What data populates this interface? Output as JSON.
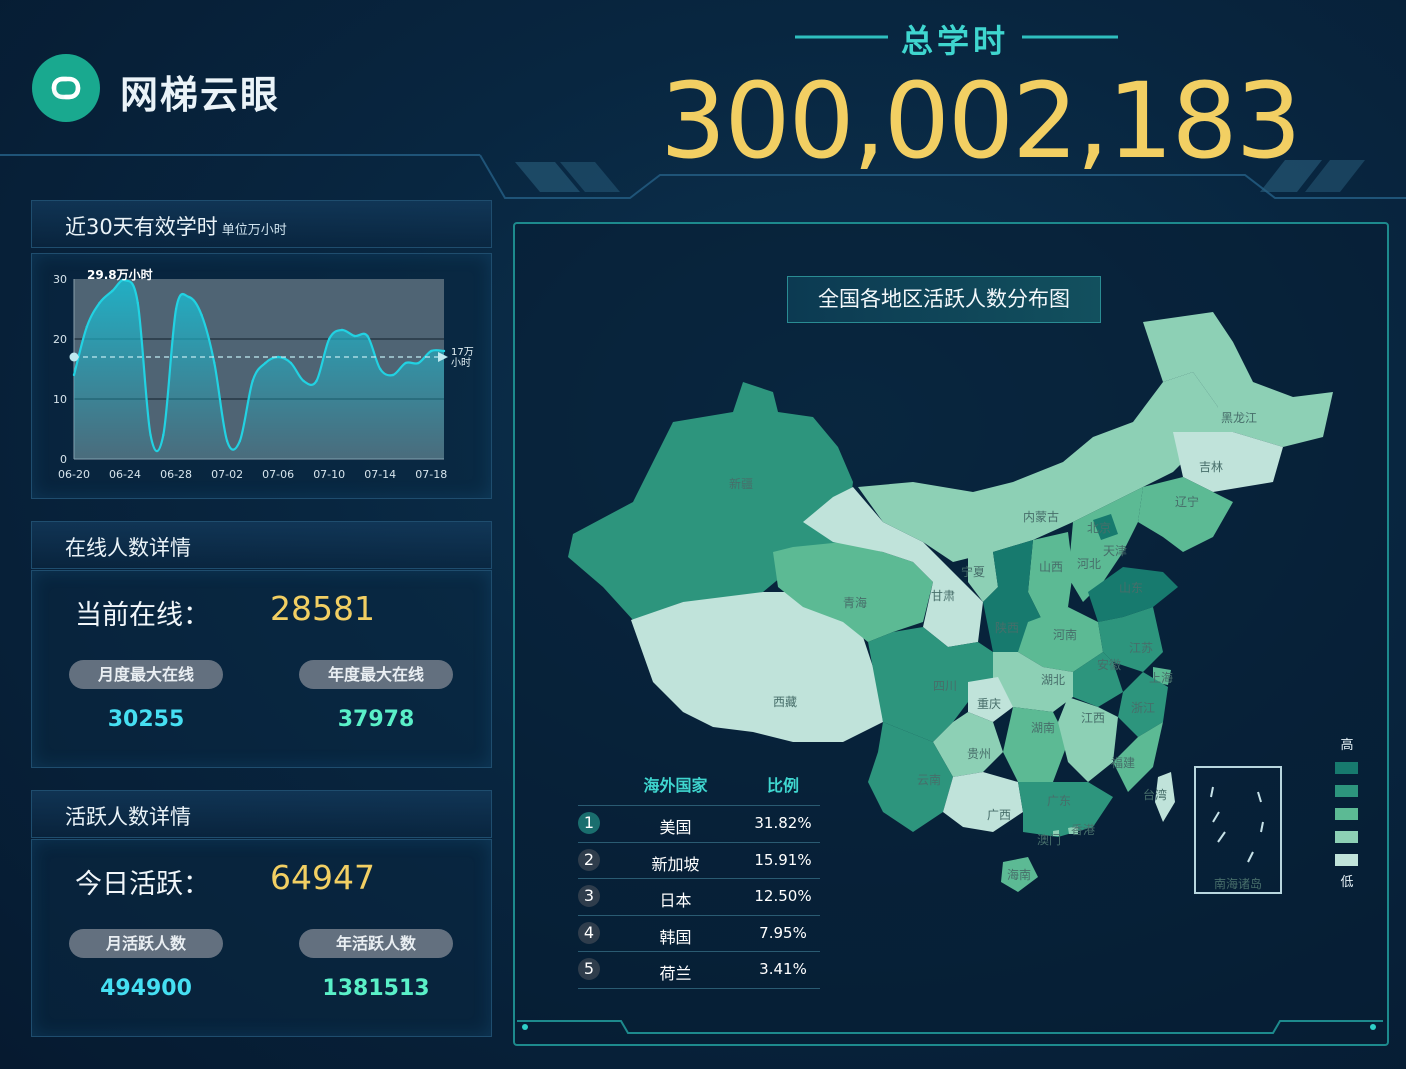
{
  "brand": {
    "name": "网梯云眼",
    "logo_icon": "infinity-link-icon"
  },
  "header": {
    "total_label": "总学时",
    "total_value": "300,002,183"
  },
  "study": {
    "title": "近30天有效学时",
    "unit": "单位万小时",
    "peak_label": "29.8万小时",
    "avg_label_1": "17万",
    "avg_label_2": "小时"
  },
  "online": {
    "title": "在线人数详情",
    "current_label": "当前在线：",
    "current_value": "28581",
    "month_max_label": "月度最大在线",
    "month_max_value": "30255",
    "year_max_label": "年度最大在线",
    "year_max_value": "37978"
  },
  "active": {
    "title": "活跃人数详情",
    "today_label": "今日活跃：",
    "today_value": "64947",
    "month_label": "月活跃人数",
    "month_value": "494900",
    "year_label": "年活跃人数",
    "year_value": "1381513"
  },
  "map": {
    "title": "全国各地区活跃人数分布图",
    "legend_high": "高",
    "legend_low": "低",
    "legend_colors": [
      "#177a6e",
      "#2d957d",
      "#5cba94",
      "#8dd0b5",
      "#c0e3da"
    ],
    "inset_label": "南海诸岛",
    "provinces": [
      "新疆",
      "西藏",
      "青海",
      "甘肃",
      "宁夏",
      "内蒙古",
      "黑龙江",
      "吉林",
      "辽宁",
      "北京",
      "天津",
      "河北",
      "山西",
      "山东",
      "陕西",
      "河南",
      "江苏",
      "安徽",
      "上海",
      "四川",
      "重庆",
      "湖北",
      "浙江",
      "湖南",
      "江西",
      "贵州",
      "云南",
      "广西",
      "广东",
      "福建",
      "台湾",
      "海南",
      "香港",
      "澳门"
    ]
  },
  "ranking": {
    "col_country": "海外国家",
    "col_ratio": "比例",
    "rows": [
      {
        "rank": "1",
        "country": "美国",
        "ratio": "31.82%"
      },
      {
        "rank": "2",
        "country": "新加坡",
        "ratio": "15.91%"
      },
      {
        "rank": "3",
        "country": "日本",
        "ratio": "12.50%"
      },
      {
        "rank": "4",
        "country": "韩国",
        "ratio": "7.95%"
      },
      {
        "rank": "5",
        "country": "荷兰",
        "ratio": "3.41%"
      }
    ]
  },
  "chart_data": {
    "type": "area",
    "x": [
      "06-20",
      "06-21",
      "06-22",
      "06-23",
      "06-24",
      "06-25",
      "06-26",
      "06-27",
      "06-28",
      "06-29",
      "06-30",
      "07-01",
      "07-02",
      "07-03",
      "07-04",
      "07-05",
      "07-06",
      "07-07",
      "07-08",
      "07-09",
      "07-10",
      "07-11",
      "07-12",
      "07-13",
      "07-14",
      "07-15",
      "07-16",
      "07-17",
      "07-18",
      "07-19"
    ],
    "values": [
      14,
      22,
      26,
      28,
      29.8,
      26,
      4,
      4,
      25,
      27,
      24,
      16,
      3,
      3,
      13,
      16,
      17,
      16,
      13,
      13,
      20,
      21.5,
      20.5,
      20.5,
      15,
      14,
      16,
      16,
      18,
      18
    ],
    "xticks": [
      "06-20",
      "06-24",
      "06-28",
      "07-02",
      "07-06",
      "07-10",
      "07-14",
      "07-18"
    ],
    "yticks": [
      "0",
      "10",
      "20",
      "30"
    ],
    "ylim": [
      0,
      30
    ],
    "avg_line": 17,
    "peak_annotation": "29.8万小时",
    "colors": {
      "line": "#22d2e2",
      "fill_top": "#19a9c0",
      "plot_bg": "#4f6474",
      "avg_line": "#bfe9f0"
    }
  }
}
